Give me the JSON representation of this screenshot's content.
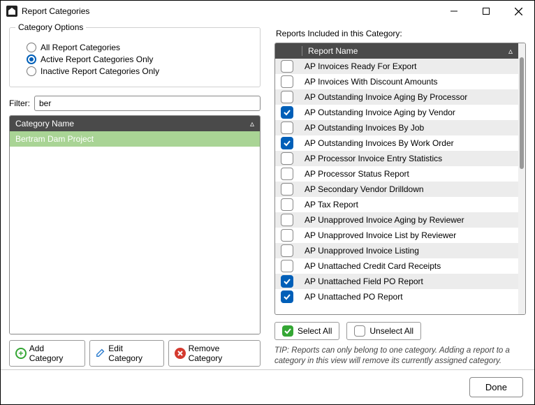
{
  "window": {
    "title": "Report Categories"
  },
  "categoryOptions": {
    "legend": "Category Options",
    "options": [
      {
        "label": "All Report Categories",
        "checked": false
      },
      {
        "label": "Active Report Categories Only",
        "checked": true
      },
      {
        "label": "Inactive Report Categories Only",
        "checked": false
      }
    ]
  },
  "filter": {
    "label": "Filter:",
    "value": "ber"
  },
  "categoryGrid": {
    "header": "Category Name",
    "rows": [
      {
        "name": "Bertram Dam Project",
        "selected": true
      }
    ]
  },
  "actions": {
    "add": "Add Category",
    "edit": "Edit Category",
    "remove": "Remove Category"
  },
  "reportsSection": {
    "label": "Reports Included in this Category:",
    "header": "Report Name",
    "rows": [
      {
        "name": "AP Invoices Ready For Export",
        "checked": false
      },
      {
        "name": "AP Invoices With Discount Amounts",
        "checked": false
      },
      {
        "name": "AP Outstanding Invoice Aging By Processor",
        "checked": false
      },
      {
        "name": "AP Outstanding Invoice Aging by Vendor",
        "checked": true
      },
      {
        "name": "AP Outstanding Invoices By Job",
        "checked": false
      },
      {
        "name": "AP Outstanding Invoices By Work Order",
        "checked": true
      },
      {
        "name": "AP Processor Invoice Entry Statistics",
        "checked": false
      },
      {
        "name": "AP Processor Status Report",
        "checked": false
      },
      {
        "name": "AP Secondary Vendor Drilldown",
        "checked": false
      },
      {
        "name": "AP Tax Report",
        "checked": false
      },
      {
        "name": "AP Unapproved Invoice Aging by Reviewer",
        "checked": false
      },
      {
        "name": "AP Unapproved Invoice List by Reviewer",
        "checked": false
      },
      {
        "name": "AP Unapproved Invoice Listing",
        "checked": false
      },
      {
        "name": "AP Unattached Credit Card Receipts",
        "checked": false
      },
      {
        "name": "AP Unattached Field PO Report",
        "checked": true
      },
      {
        "name": "AP Unattached PO Report",
        "checked": true
      }
    ],
    "selectAll": "Select All",
    "unselectAll": "Unselect All",
    "tip": "TIP:  Reports can only belong to one category.  Adding a report to a category in this view will remove its currently assigned category."
  },
  "footer": {
    "done": "Done"
  }
}
